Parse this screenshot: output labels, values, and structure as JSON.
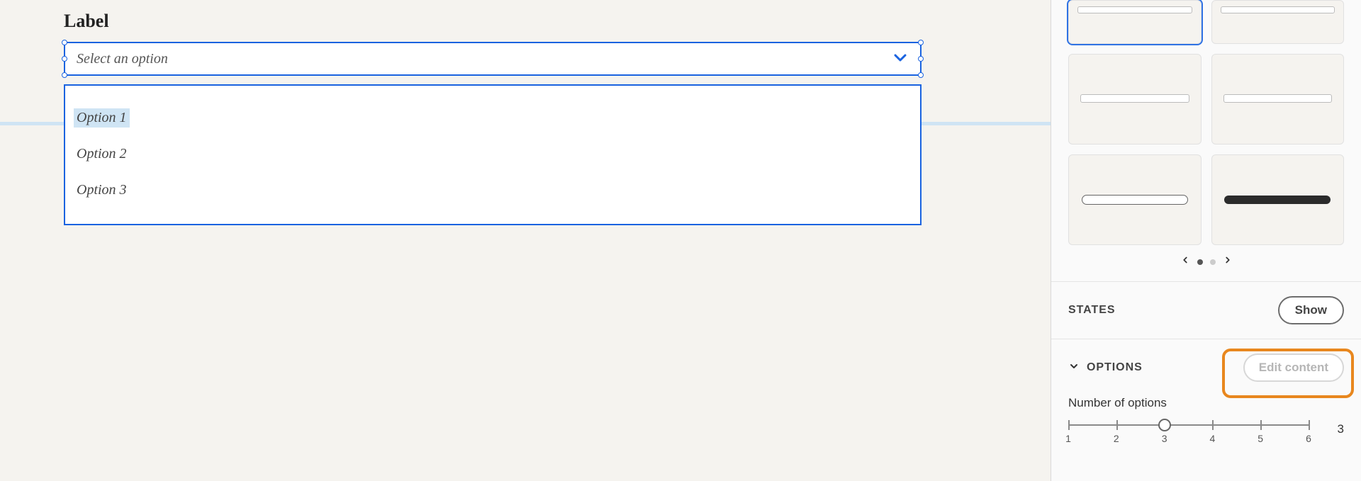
{
  "canvas": {
    "field_label": "Label",
    "placeholder": "Select an option",
    "options": [
      "Option 1",
      "Option 2",
      "Option 3"
    ]
  },
  "panel": {
    "states_title": "STATES",
    "show_label": "Show",
    "options_title": "OPTIONS",
    "edit_content_label": "Edit content",
    "num_options_label": "Number of options",
    "slider": {
      "min": 1,
      "max": 6,
      "value": 3,
      "ticks": [
        "1",
        "2",
        "3",
        "4",
        "5",
        "6"
      ]
    }
  }
}
